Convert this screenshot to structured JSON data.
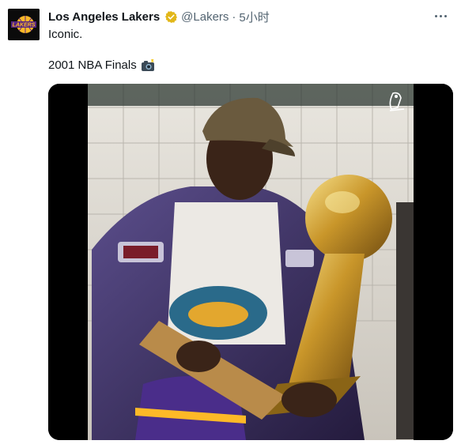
{
  "account": {
    "name": "Los Angeles Lakers",
    "handle": "@Lakers",
    "separator": "·",
    "time": "5小时",
    "verified_icon": "gold-verified-badge",
    "avatar_text": "LAKERS"
  },
  "tweet": {
    "line1": "Iconic.",
    "line2": "2001 NBA Finals",
    "emoji_icon": "camera-with-flash-icon"
  },
  "menu": {
    "icon": "more-horizontal-icon"
  },
  "media": {
    "kind": "video",
    "overlay_icon": "nba-logo-icon"
  },
  "colors": {
    "lakers_purple": "#552583",
    "lakers_gold": "#FDB927",
    "secondary_text": "#536471",
    "primary_text": "#0f1419"
  }
}
